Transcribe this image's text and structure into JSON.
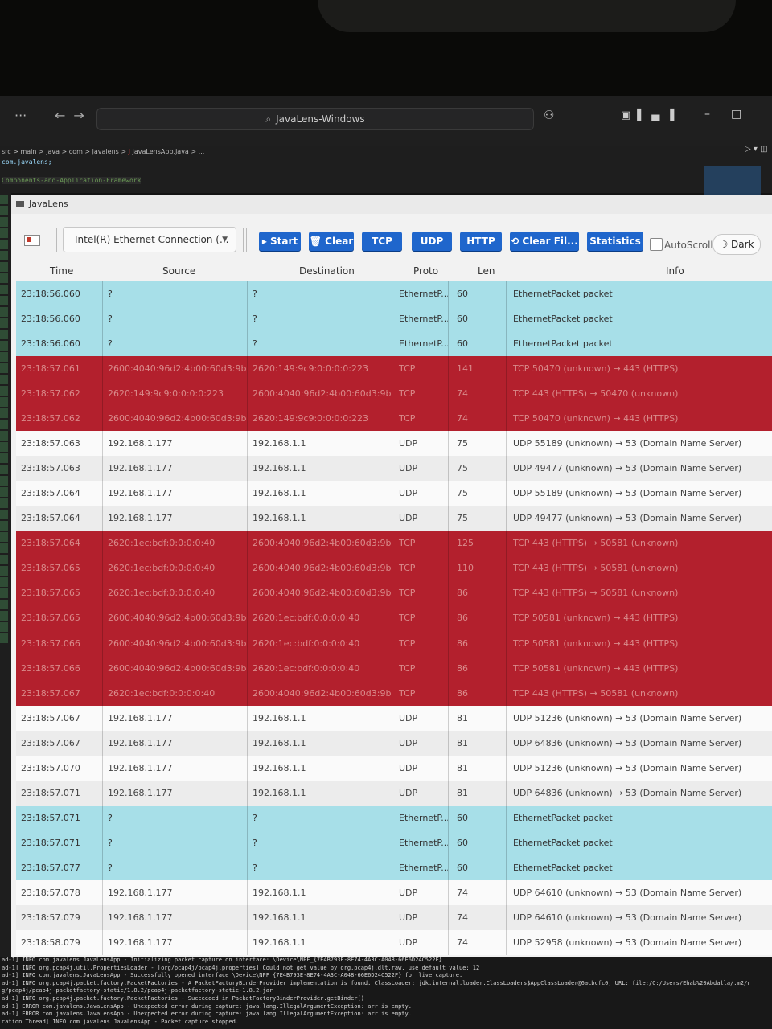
{
  "ide": {
    "search_text": "JavaLens-Windows",
    "breadcrumb": "src > main > java > com > javalens > ",
    "breadcrumb_file": "JavaLensApp.java > ...",
    "package_line": "com.javalens;",
    "comment_line": "Components-and-Application-Framework"
  },
  "app": {
    "title": "JavaLens",
    "interface_select": "Intel(R) Ethernet Connection (...",
    "buttons": {
      "start": "▸ Start",
      "clear": "🗑 Clear",
      "tcp": "TCP",
      "udp": "UDP",
      "http": "HTTP",
      "clear_filter": "⟲ Clear Fil...",
      "statistics": "Statistics"
    },
    "autoscroll_label": "AutoScroll",
    "dark_label": "☽ Dark",
    "columns": [
      "Time",
      "Source",
      "Destination",
      "Proto",
      "Len",
      "Info"
    ],
    "rows": [
      {
        "type": "eth",
        "time": "23:18:56.060",
        "src": "?",
        "dst": "?",
        "proto": "EthernetP...",
        "len": "60",
        "info": "EthernetPacket packet"
      },
      {
        "type": "eth",
        "time": "23:18:56.060",
        "src": "?",
        "dst": "?",
        "proto": "EthernetP...",
        "len": "60",
        "info": "EthernetPacket packet"
      },
      {
        "type": "eth",
        "time": "23:18:56.060",
        "src": "?",
        "dst": "?",
        "proto": "EthernetP...",
        "len": "60",
        "info": "EthernetPacket packet"
      },
      {
        "type": "tcp",
        "time": "23:18:57.061",
        "src": "2600:4040:96d2:4b00:60d3:9b...",
        "dst": "2620:149:9c9:0:0:0:0:223",
        "proto": "TCP",
        "len": "141",
        "info": "TCP 50470 (unknown) → 443 (HTTPS)"
      },
      {
        "type": "tcp",
        "time": "23:18:57.062",
        "src": "2620:149:9c9:0:0:0:0:223",
        "dst": "2600:4040:96d2:4b00:60d3:9b...",
        "proto": "TCP",
        "len": "74",
        "info": "TCP 443 (HTTPS) → 50470 (unknown)"
      },
      {
        "type": "tcp",
        "time": "23:18:57.062",
        "src": "2600:4040:96d2:4b00:60d3:9b...",
        "dst": "2620:149:9c9:0:0:0:0:223",
        "proto": "TCP",
        "len": "74",
        "info": "TCP 50470 (unknown) → 443 (HTTPS)"
      },
      {
        "type": "udpA",
        "time": "23:18:57.063",
        "src": "192.168.1.177",
        "dst": "192.168.1.1",
        "proto": "UDP",
        "len": "75",
        "info": "UDP 55189 (unknown) → 53 (Domain Name Server)"
      },
      {
        "type": "udpB",
        "time": "23:18:57.063",
        "src": "192.168.1.177",
        "dst": "192.168.1.1",
        "proto": "UDP",
        "len": "75",
        "info": "UDP 49477 (unknown) → 53 (Domain Name Server)"
      },
      {
        "type": "udpA",
        "time": "23:18:57.064",
        "src": "192.168.1.177",
        "dst": "192.168.1.1",
        "proto": "UDP",
        "len": "75",
        "info": "UDP 55189 (unknown) → 53 (Domain Name Server)"
      },
      {
        "type": "udpB",
        "time": "23:18:57.064",
        "src": "192.168.1.177",
        "dst": "192.168.1.1",
        "proto": "UDP",
        "len": "75",
        "info": "UDP 49477 (unknown) → 53 (Domain Name Server)"
      },
      {
        "type": "tcp",
        "time": "23:18:57.064",
        "src": "2620:1ec:bdf:0:0:0:0:40",
        "dst": "2600:4040:96d2:4b00:60d3:9b...",
        "proto": "TCP",
        "len": "125",
        "info": "TCP 443 (HTTPS) → 50581 (unknown)"
      },
      {
        "type": "tcp",
        "time": "23:18:57.065",
        "src": "2620:1ec:bdf:0:0:0:0:40",
        "dst": "2600:4040:96d2:4b00:60d3:9b...",
        "proto": "TCP",
        "len": "110",
        "info": "TCP 443 (HTTPS) → 50581 (unknown)"
      },
      {
        "type": "tcp",
        "time": "23:18:57.065",
        "src": "2620:1ec:bdf:0:0:0:0:40",
        "dst": "2600:4040:96d2:4b00:60d3:9b...",
        "proto": "TCP",
        "len": "86",
        "info": "TCP 443 (HTTPS) → 50581 (unknown)"
      },
      {
        "type": "tcp",
        "time": "23:18:57.065",
        "src": "2600:4040:96d2:4b00:60d3:9b...",
        "dst": "2620:1ec:bdf:0:0:0:0:40",
        "proto": "TCP",
        "len": "86",
        "info": "TCP 50581 (unknown) → 443 (HTTPS)"
      },
      {
        "type": "tcp",
        "time": "23:18:57.066",
        "src": "2600:4040:96d2:4b00:60d3:9b...",
        "dst": "2620:1ec:bdf:0:0:0:0:40",
        "proto": "TCP",
        "len": "86",
        "info": "TCP 50581 (unknown) → 443 (HTTPS)"
      },
      {
        "type": "tcp",
        "time": "23:18:57.066",
        "src": "2600:4040:96d2:4b00:60d3:9b...",
        "dst": "2620:1ec:bdf:0:0:0:0:40",
        "proto": "TCP",
        "len": "86",
        "info": "TCP 50581 (unknown) → 443 (HTTPS)"
      },
      {
        "type": "tcp",
        "time": "23:18:57.067",
        "src": "2620:1ec:bdf:0:0:0:0:40",
        "dst": "2600:4040:96d2:4b00:60d3:9b...",
        "proto": "TCP",
        "len": "86",
        "info": "TCP 443 (HTTPS) → 50581 (unknown)"
      },
      {
        "type": "udpA",
        "time": "23:18:57.067",
        "src": "192.168.1.177",
        "dst": "192.168.1.1",
        "proto": "UDP",
        "len": "81",
        "info": "UDP 51236 (unknown) → 53 (Domain Name Server)"
      },
      {
        "type": "udpB",
        "time": "23:18:57.067",
        "src": "192.168.1.177",
        "dst": "192.168.1.1",
        "proto": "UDP",
        "len": "81",
        "info": "UDP 64836 (unknown) → 53 (Domain Name Server)"
      },
      {
        "type": "udpA",
        "time": "23:18:57.070",
        "src": "192.168.1.177",
        "dst": "192.168.1.1",
        "proto": "UDP",
        "len": "81",
        "info": "UDP 51236 (unknown) → 53 (Domain Name Server)"
      },
      {
        "type": "udpB",
        "time": "23:18:57.071",
        "src": "192.168.1.177",
        "dst": "192.168.1.1",
        "proto": "UDP",
        "len": "81",
        "info": "UDP 64836 (unknown) → 53 (Domain Name Server)"
      },
      {
        "type": "eth",
        "time": "23:18:57.071",
        "src": "?",
        "dst": "?",
        "proto": "EthernetP...",
        "len": "60",
        "info": "EthernetPacket packet"
      },
      {
        "type": "eth",
        "time": "23:18:57.071",
        "src": "?",
        "dst": "?",
        "proto": "EthernetP...",
        "len": "60",
        "info": "EthernetPacket packet"
      },
      {
        "type": "eth",
        "time": "23:18:57.077",
        "src": "?",
        "dst": "?",
        "proto": "EthernetP...",
        "len": "60",
        "info": "EthernetPacket packet"
      },
      {
        "type": "udpA",
        "time": "23:18:57.078",
        "src": "192.168.1.177",
        "dst": "192.168.1.1",
        "proto": "UDP",
        "len": "74",
        "info": "UDP 64610 (unknown) → 53 (Domain Name Server)"
      },
      {
        "type": "udpB",
        "time": "23:18:57.079",
        "src": "192.168.1.177",
        "dst": "192.168.1.1",
        "proto": "UDP",
        "len": "74",
        "info": "UDP 64610 (unknown) → 53 (Domain Name Server)"
      },
      {
        "type": "udpA",
        "time": "23:18:58.079",
        "src": "192.168.1.177",
        "dst": "192.168.1.1",
        "proto": "UDP",
        "len": "74",
        "info": "UDP 52958 (unknown) → 53 (Domain Name Server)"
      }
    ]
  },
  "console_lines": [
    "ad-1] INFO com.javalens.JavaLensApp - Initializing packet capture on interface: \\Device\\NPF_{7E4B793E-8E74-4A3C-A048-66E6D24C522F}",
    "ad-1] INFO org.pcap4j.util.PropertiesLoader - [org/pcap4j/pcap4j.properties] Could not get value by org.pcap4j.dlt.raw, use default value: 12",
    "ad-1] INFO com.javalens.JavaLensApp - Successfully opened interface \\Device\\NPF_{7E4B793E-8E74-4A3C-A048-66E6D24C522F} for live capture.",
    "ad-1] INFO org.pcap4j.packet.factory.PacketFactories - A PacketFactoryBinderProvider implementation is found. ClassLoader: jdk.internal.loader.ClassLoaders$AppClassLoader@6acbcfc0, URL: file:/C:/Users/Ehab%20Abdalla/.m2/r",
    "g/pcap4j/pcap4j-packetfactory-static/1.8.2/pcap4j-packetfactory-static-1.8.2.jar",
    "ad-1] INFO org.pcap4j.packet.factory.PacketFactories - Succeeded in PacketFactoryBinderProvider.getBinder()",
    "ad-1] ERROR com.javalens.JavaLensApp - Unexpected error during capture: java.lang.IllegalArgumentException: arr is empty.",
    "ad-1] ERROR com.javalens.JavaLensApp - Unexpected error during capture: java.lang.IllegalArgumentException: arr is empty.",
    "cation Thread] INFO com.javalens.JavaLensApp - Packet capture stopped."
  ]
}
